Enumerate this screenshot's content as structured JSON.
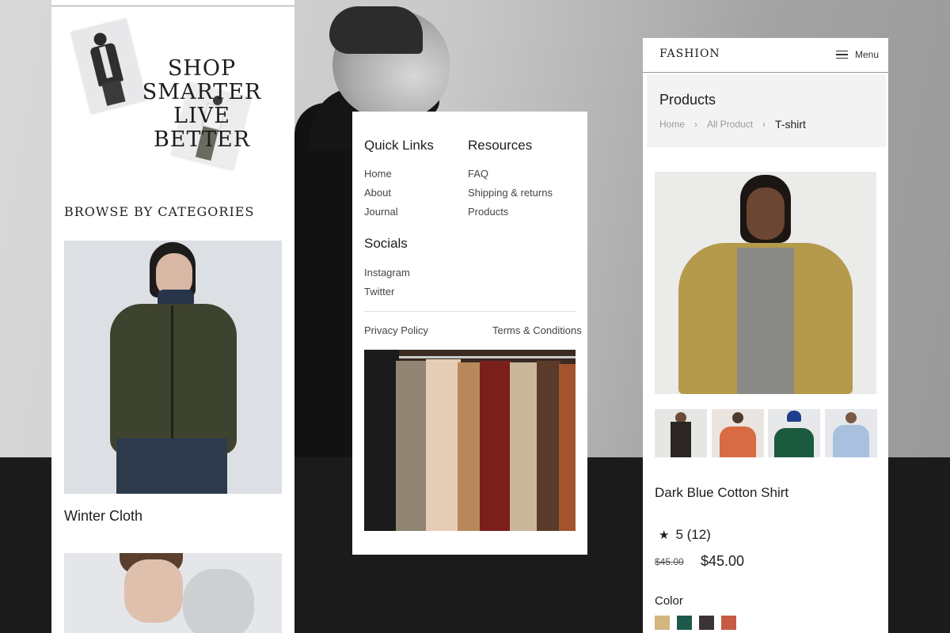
{
  "left_panel": {
    "hero_lines": [
      "SHOP",
      "SMARTER LIVE",
      "BETTER"
    ],
    "section_heading": "BROWSE BY CATEGORIES",
    "category_label": "Winter Cloth"
  },
  "footer_panel": {
    "quick_links": {
      "heading": "Quick Links",
      "items": [
        "Home",
        "About",
        "Journal"
      ]
    },
    "resources": {
      "heading": "Resources",
      "items": [
        "FAQ",
        "Shipping & returns",
        "Products"
      ]
    },
    "socials": {
      "heading": "Socials",
      "items": [
        "Instagram",
        "Twitter"
      ]
    },
    "privacy_label": "Privacy Policy",
    "terms_label": "Terms & Conditions"
  },
  "product_panel": {
    "logo": "FASHION",
    "menu_label": "Menu",
    "page_title": "Products",
    "breadcrumb": [
      "Home",
      "All Product",
      "T-shirt"
    ],
    "product_title": "Dark Blue Cotton Shirt",
    "rating": "5 (12)",
    "price_old": "$45.00",
    "price_new": "$45.00",
    "color_label": "Color",
    "swatches": [
      "#d4b67f",
      "#1e5a4b",
      "#3b3436",
      "#c75a42"
    ],
    "icons": {
      "menu": "hamburger-menu-icon",
      "star": "star-icon",
      "chevron": "chevron-right-icon"
    }
  }
}
